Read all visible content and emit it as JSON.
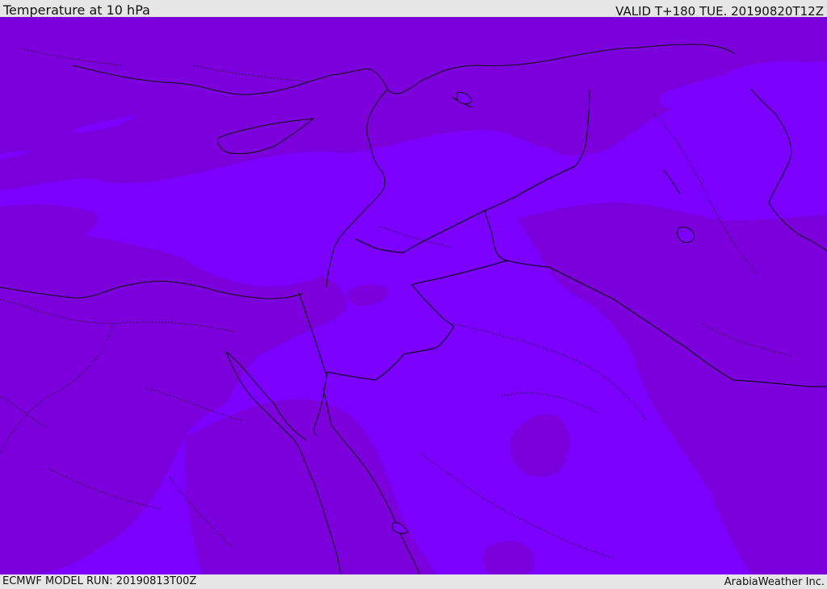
{
  "header": {
    "title": "Temperature at 10 hPa",
    "valid": "VALID T+180 TUE. 20190820T12Z"
  },
  "footer": {
    "model_run": "ECMWF MODEL RUN: 20190813T00Z",
    "credit": "ArabiaWeather Inc."
  },
  "colors": {
    "field_light": "#7b00ff",
    "field_dark": "#7c00db",
    "coastline": "#111111",
    "border": "#222222",
    "bar_background": "#e6e6e6"
  }
}
